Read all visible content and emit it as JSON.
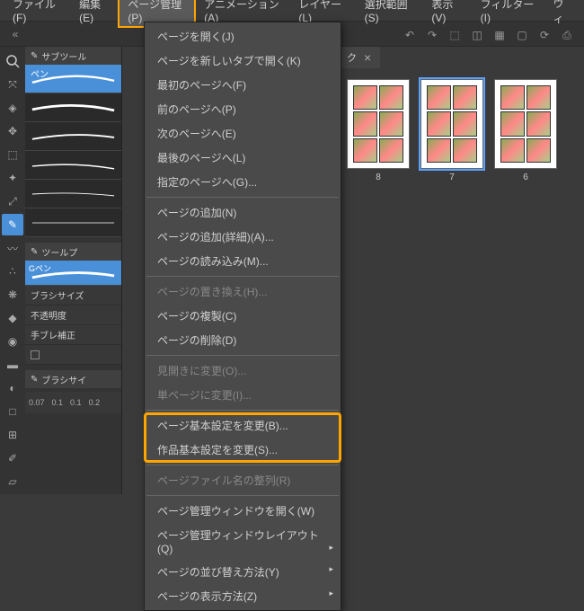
{
  "menubar": {
    "items": [
      {
        "label": "ファイル(F)"
      },
      {
        "label": "編集(E)"
      },
      {
        "label": "ページ管理(P)",
        "active": true
      },
      {
        "label": "アニメーション(A)"
      },
      {
        "label": "レイヤー(L)"
      },
      {
        "label": "選択範囲(S)"
      },
      {
        "label": "表示(V)"
      },
      {
        "label": "フィルター(I)"
      },
      {
        "label": "ウィ"
      }
    ]
  },
  "dropdown": {
    "groups": [
      [
        {
          "label": "ページを開く(J)"
        },
        {
          "label": "ページを新しいタブで開く(K)"
        },
        {
          "label": "最初のページへ(F)"
        },
        {
          "label": "前のページへ(P)"
        },
        {
          "label": "次のページへ(E)"
        },
        {
          "label": "最後のページへ(L)"
        },
        {
          "label": "指定のページへ(G)..."
        }
      ],
      [
        {
          "label": "ページの追加(N)"
        },
        {
          "label": "ページの追加(詳細)(A)..."
        },
        {
          "label": "ページの読み込み(M)..."
        }
      ],
      [
        {
          "label": "ページの置き換え(H)...",
          "disabled": true
        },
        {
          "label": "ページの複製(C)"
        },
        {
          "label": "ページの削除(D)"
        }
      ],
      [
        {
          "label": "見開きに変更(O)...",
          "disabled": true
        },
        {
          "label": "単ページに変更(I)...",
          "disabled": true
        }
      ],
      [
        {
          "label": "ページ基本設定を変更(B)...",
          "highlight": true
        },
        {
          "label": "作品基本設定を変更(S)...",
          "highlight": true
        }
      ],
      [
        {
          "label": "ページファイル名の整列(R)",
          "disabled": true
        }
      ],
      [
        {
          "label": "ページ管理ウィンドウを開く(W)"
        },
        {
          "label": "ページ管理ウィンドウレイアウト(Q)",
          "submenu": true
        },
        {
          "label": "ページの並び替え方法(Y)",
          "submenu": true
        },
        {
          "label": "ページの表示方法(Z)",
          "submenu": true
        }
      ]
    ]
  },
  "panels": {
    "subtool_title": "サブツール",
    "subtool_active": "ペン",
    "toolprops_title": "ツールプ",
    "brush_name": "Gペン",
    "props": [
      {
        "label": "ブラシサイズ"
      },
      {
        "label": "不透明度"
      },
      {
        "label": "手ブレ補正"
      }
    ],
    "brushsize_title": "ブラシサイ"
  },
  "ruler": {
    "ticks": [
      "0.07",
      "0.1",
      "0.1",
      "0.2"
    ]
  },
  "tab": {
    "label": "ク",
    "close": "×"
  },
  "thumbs": [
    {
      "num": "8",
      "selected": false
    },
    {
      "num": "7",
      "selected": true
    },
    {
      "num": "6",
      "selected": false
    }
  ]
}
